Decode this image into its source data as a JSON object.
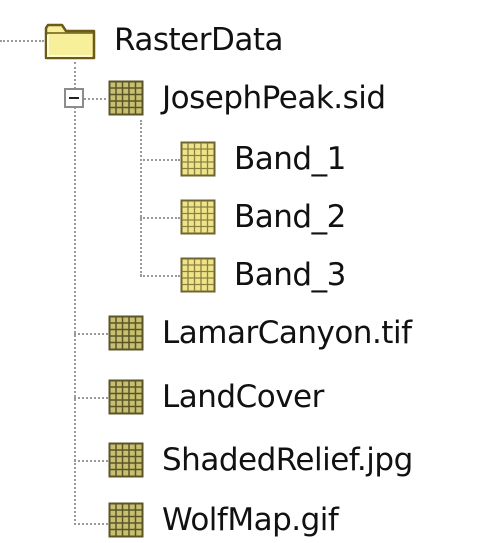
{
  "tree": {
    "root": {
      "label": "RasterData",
      "icon": "folder-icon",
      "expanded": true
    },
    "items": [
      {
        "label": "JosephPeak.sid",
        "icon": "raster-dataset-icon",
        "expanded": true,
        "expander_icon": "collapse-minus-icon",
        "children": [
          {
            "label": "Band_1",
            "icon": "raster-band-icon"
          },
          {
            "label": "Band_2",
            "icon": "raster-band-icon"
          },
          {
            "label": "Band_3",
            "icon": "raster-band-icon"
          }
        ]
      },
      {
        "label": "LamarCanyon.tif",
        "icon": "raster-dataset-icon"
      },
      {
        "label": "LandCover",
        "icon": "raster-dataset-icon"
      },
      {
        "label": "ShadedRelief.jpg",
        "icon": "raster-dataset-icon"
      },
      {
        "label": "WolfMap.gif",
        "icon": "raster-dataset-icon"
      }
    ]
  },
  "colors": {
    "folder_fill": "#f7ef9a",
    "folder_stroke": "#6b5a1a",
    "raster_fill": "#c8c070",
    "raster_grid": "#5a5528",
    "band_fill": "#f0e48a",
    "tree_line": "#9a9a9a"
  }
}
